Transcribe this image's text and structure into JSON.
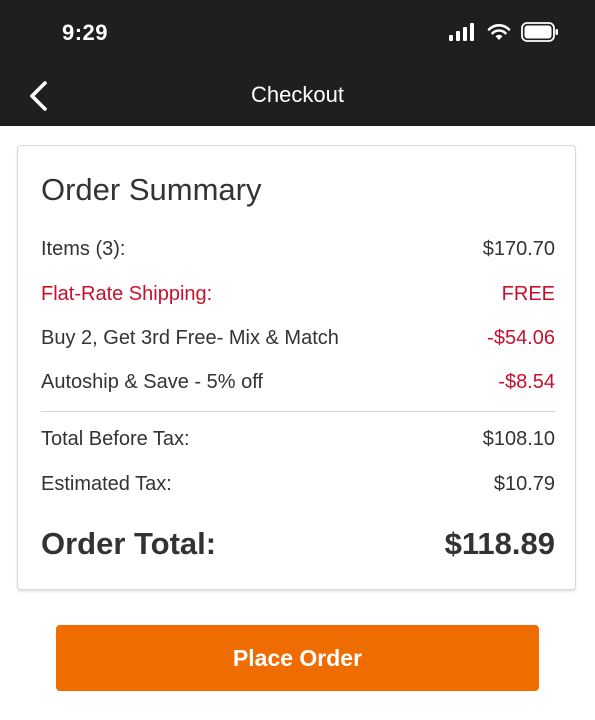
{
  "status_bar": {
    "time": "9:29",
    "icons": [
      "cellular-signal-icon",
      "wifi-icon",
      "battery-icon"
    ]
  },
  "nav": {
    "title": "Checkout",
    "back_icon": "chevron-left-icon"
  },
  "summary": {
    "title": "Order Summary",
    "lines": [
      {
        "label": "Items (3):",
        "value": "$170.70",
        "style": "normal"
      },
      {
        "label": "Flat-Rate Shipping:",
        "value": "FREE",
        "style": "red"
      },
      {
        "label": "Buy 2, Get 3rd Free- Mix & Match",
        "value": "-$54.06",
        "style": "red-value"
      },
      {
        "label": "Autoship & Save - 5% off",
        "value": "-$8.54",
        "style": "red-value"
      },
      {
        "label": "Total Before Tax:",
        "value": "$108.10",
        "style": "normal"
      },
      {
        "label": "Estimated Tax:",
        "value": "$10.79",
        "style": "normal"
      }
    ],
    "total_label": "Order Total:",
    "total_value": "$118.89"
  },
  "actions": {
    "place_order_label": "Place Order"
  },
  "colors": {
    "header_bg": "#1f1f1f",
    "accent_orange": "#ef6c00",
    "discount_red": "#c8102e",
    "text": "#333333"
  }
}
